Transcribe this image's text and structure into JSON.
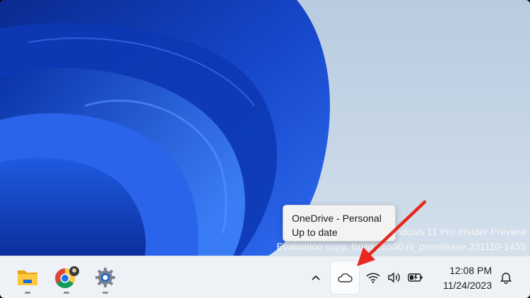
{
  "desktop": {
    "watermark_line1": "Windows 11 Pro Insider Preview",
    "watermark_line2": "Evaluation copy. Build 25590.ni_prerelease.231110-1455"
  },
  "tooltip": {
    "title": "OneDrive - Personal",
    "status": "Up to date"
  },
  "taskbar": {
    "apps": [
      {
        "name": "File Explorer",
        "icon": "folder-icon"
      },
      {
        "name": "Google Chrome",
        "icon": "chrome-icon"
      },
      {
        "name": "Settings",
        "icon": "gear-icon"
      }
    ],
    "tray": {
      "overflow_icon": "chevron-up-icon",
      "onedrive_icon": "cloud-icon",
      "network_icon": "wifi-icon",
      "volume_icon": "speaker-icon",
      "battery_icon": "battery-charging-icon",
      "notification_icon": "bell-icon"
    },
    "clock": {
      "time": "12:08 PM",
      "date": "11/24/2023"
    }
  },
  "colors": {
    "annotation_arrow": "#e8281e",
    "wallpaper_blue": "#1a4fd6",
    "taskbar_bg": "#eef1f6"
  }
}
